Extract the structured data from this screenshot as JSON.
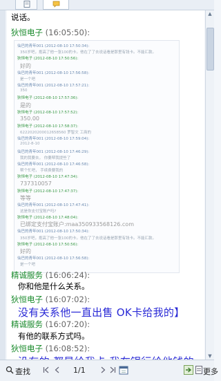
{
  "chat": {
    "top_fragment": "说话。",
    "messages": [
      {
        "sender": "狄恒电子",
        "time": "(16:05:50):"
      },
      {
        "sender": "精诚服务",
        "time": "(16:06:24):",
        "text": "你和他是什么关系。"
      },
      {
        "sender": "狄恒电子",
        "time": "(16:07:02):",
        "text": "没有关系他一直出售 OK卡给我的】"
      },
      {
        "sender": "精诚服务",
        "time": "(16:07:20):",
        "text": "有他的联系方式吗。"
      },
      {
        "sender": "狄恒电子",
        "time": "(16:08:52):",
        "text": "没有的  都是给我卡  我在银行给他钱的"
      }
    ],
    "pasted_image": {
      "lines": [
        {
          "t": "仙巴的青年001 (2012-08-10 17:50:34):",
          "c": "b"
        },
        {
          "t": "350岁吧，抱高了他一张100的卡。他在了了去说话看是那里有钱卡。不能汇款。",
          "c": "s"
        },
        {
          "t": "狄恒电子 (2012-08-10 17:50:56):",
          "c": "g"
        },
        {
          "t": "好的",
          "c": "m"
        },
        {
          "t": "仙巴的青年001 (2012-08-10 17:56:58):",
          "c": "b"
        },
        {
          "t": "是一个吧",
          "c": "s"
        },
        {
          "t": "仙巴的青年001 (2012-08-10 17:57:21):",
          "c": "b"
        },
        {
          "t": "350",
          "c": "s"
        },
        {
          "t": "狄恒电子 (2012-08-10 17:57:36):",
          "c": "g"
        },
        {
          "t": "是的",
          "c": "m"
        },
        {
          "t": "狄恒电子 (2012-08-10 17:57:52):",
          "c": "g"
        },
        {
          "t": "350.00",
          "c": "m"
        },
        {
          "t": "狄恒电子 (2012-08-10 17:58:37):",
          "c": "g"
        },
        {
          "t": "6222020200012658560  罗智文  工商的",
          "c": "s"
        },
        {
          "t": "仙巴的青年001 (2012-08-10 17:59:04):",
          "c": "b"
        },
        {
          "t": "2012-8-10",
          "c": "s"
        },
        {
          "t": "仙巴的青年001 (2012-08-10 17:46:29):",
          "c": "b"
        },
        {
          "t": "我的我要去，  你要帮我提些了",
          "c": "s"
        },
        {
          "t": "仙巴的青年001 (2012-08-10 17:46:58):",
          "c": "b"
        },
        {
          "t": "帮个忙吧，  手续费要我的",
          "c": "s"
        },
        {
          "t": "狄恒电子 (2012-08-10 17:47:34):",
          "c": "g"
        },
        {
          "t": "737310057",
          "c": "m"
        },
        {
          "t": "狄恒电子 (2012-08-10 17:47:37):",
          "c": "g"
        },
        {
          "t": "等等",
          "c": "m"
        },
        {
          "t": "仙巴的青年001 (2012-08-10 17:47:41):",
          "c": "b"
        },
        {
          "t": "这是你支付宝账户吗?",
          "c": "s"
        },
        {
          "t": "狄恒电子 (2012-08-10 17:48:04):",
          "c": "g"
        },
        {
          "t": "已绑定支付宝账户:maa350933568126.com",
          "c": "m"
        },
        {
          "t": "仙巴的青年001 (2012-08-10 17:50:34):",
          "c": "b"
        },
        {
          "t": "350岁吧，抱高了他一张100的卡。他在了了去说话看是那里有钱卡。不能汇款。",
          "c": "s"
        },
        {
          "t": "狄恒电子 (2012-08-10 17:50:56):",
          "c": "g"
        },
        {
          "t": "好的",
          "c": "m"
        },
        {
          "t": "仙巴的青年001 (2012-08-10 17:56:58):",
          "c": "b"
        },
        {
          "t": "是一个吧",
          "c": "s"
        }
      ]
    }
  },
  "toolbar": {
    "search_label": "查找",
    "page_indicator": "1/1",
    "more_label": "更多"
  },
  "colors": {
    "sender": "#1a8a2c",
    "highlight_text": "#2a2ad6"
  }
}
